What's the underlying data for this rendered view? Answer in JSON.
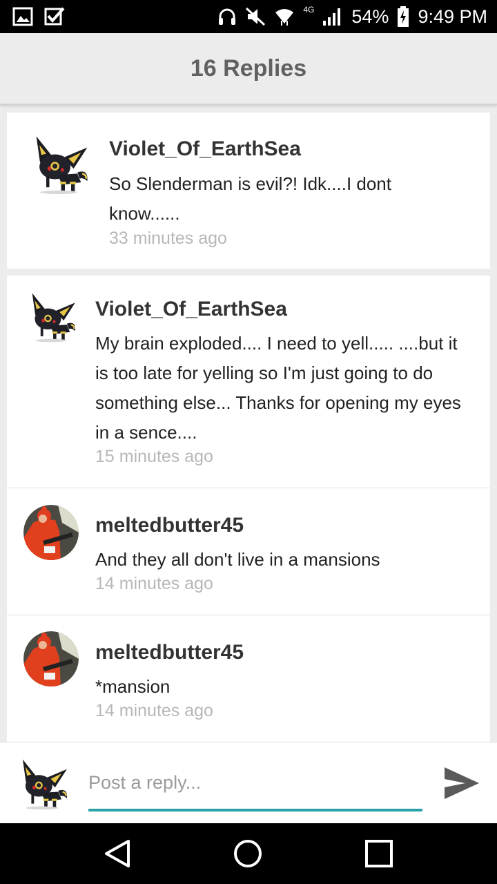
{
  "status_bar": {
    "network": "4G",
    "battery": "54%",
    "time": "9:49 PM",
    "icons": [
      "gallery-icon",
      "checkbox-icon",
      "headphones-icon",
      "mute-icon",
      "wifi-icon",
      "signal-icon",
      "battery-charging-icon"
    ]
  },
  "header": {
    "title": "16 Replies"
  },
  "root_comment": {
    "username": "Violet_Of_EarthSea",
    "avatar": "umbreon-avatar",
    "message": "So Slenderman is evil?! Idk....I dont know......",
    "time": "33 minutes ago"
  },
  "replies": [
    {
      "username": "Violet_Of_EarthSea",
      "avatar": "umbreon-avatar",
      "message": "My brain exploded.... I need to yell..... ....but it is too late for yelling so I'm just going to do something else... Thanks for opening my eyes in a sence....",
      "time": "15 minutes ago"
    },
    {
      "username": "meltedbutter45",
      "avatar": "red-costume-avatar",
      "message": "And they all don't live in a mansions",
      "time": "14 minutes ago"
    },
    {
      "username": "meltedbutter45",
      "avatar": "red-costume-avatar",
      "message": "*mansion",
      "time": "14 minutes ago"
    }
  ],
  "composer": {
    "placeholder": "Post a reply...",
    "avatar": "umbreon-avatar",
    "send_icon": "send-icon"
  },
  "nav_bar": {
    "icons": [
      "back-icon",
      "home-icon",
      "recents-icon"
    ]
  },
  "colors": {
    "accent": "#2aa1a8",
    "header_bg": "#ececec",
    "timestamp": "#b7b7b7",
    "username": "#333333"
  }
}
